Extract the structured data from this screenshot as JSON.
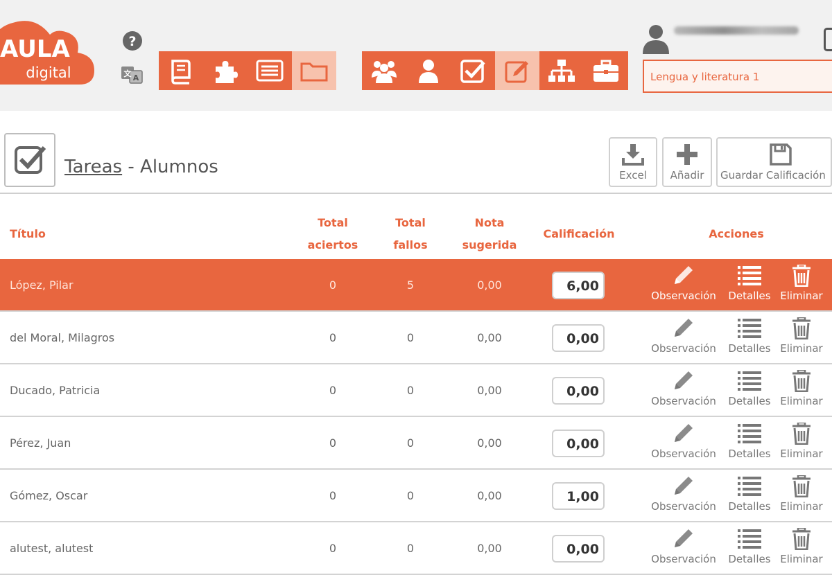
{
  "header": {
    "logo_title": "AULA",
    "logo_subtitle": "digital",
    "course_select_value": "Lengua y literatura 1",
    "toolbar_left": [
      {
        "icon": "book-icon",
        "active": true
      },
      {
        "icon": "puzzle-icon",
        "active": true
      },
      {
        "icon": "list-icon",
        "active": true
      },
      {
        "icon": "folder-icon",
        "active": false
      }
    ],
    "toolbar_right": [
      {
        "icon": "group-icon",
        "active": true
      },
      {
        "icon": "user-icon",
        "active": true
      },
      {
        "icon": "checkbox-icon",
        "active": true
      },
      {
        "icon": "edit-icon",
        "active": false
      },
      {
        "icon": "hierarchy-icon",
        "active": true
      },
      {
        "icon": "briefcase-icon",
        "active": true
      }
    ]
  },
  "page": {
    "title_link": "Tareas",
    "title_separator": " - ",
    "title_rest": "Alumnos",
    "actions": {
      "excel": "Excel",
      "add": "Añadir",
      "save": "Guardar Calificación"
    }
  },
  "table": {
    "columns": {
      "titulo": "Título",
      "total_aciertos_1": "Total",
      "total_aciertos_2": "aciertos",
      "total_fallos_1": "Total",
      "total_fallos_2": "fallos",
      "nota_1": "Nota",
      "nota_2": "sugerida",
      "calificacion": "Calificación",
      "acciones": "Acciones"
    },
    "action_labels": {
      "observacion": "Observación",
      "detalles": "Detalles",
      "eliminar": "Eliminar"
    },
    "rows": [
      {
        "name": "López, Pilar",
        "aciertos": "0",
        "fallos": "5",
        "nota": "0,00",
        "grade": "6,00",
        "selected": true
      },
      {
        "name": "del Moral, Milagros",
        "aciertos": "0",
        "fallos": "0",
        "nota": "0,00",
        "grade": "0,00",
        "selected": false
      },
      {
        "name": "Ducado, Patricia",
        "aciertos": "0",
        "fallos": "0",
        "nota": "0,00",
        "grade": "0,00",
        "selected": false
      },
      {
        "name": "Pérez, Juan",
        "aciertos": "0",
        "fallos": "0",
        "nota": "0,00",
        "grade": "0,00",
        "selected": false
      },
      {
        "name": "Gómez, Oscar",
        "aciertos": "0",
        "fallos": "0",
        "nota": "0,00",
        "grade": "1,00",
        "selected": false
      },
      {
        "name": "alutest, alutest",
        "aciertos": "0",
        "fallos": "0",
        "nota": "0,00",
        "grade": "0,00",
        "selected": false
      }
    ]
  },
  "colors": {
    "accent": "#e8663f",
    "accent_light": "#f7c2ad",
    "topbar_bg": "#f1f1f1"
  }
}
